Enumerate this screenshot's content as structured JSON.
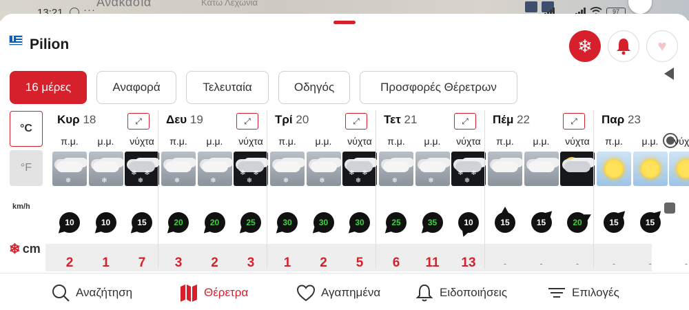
{
  "statusbar": {
    "time": "13:21",
    "battery": "97",
    "map_label": "Ανακασιά",
    "map_label_2": "Κατω Λεχώνια"
  },
  "header": {
    "title": "Pilion"
  },
  "tabs": [
    {
      "label": "16 μέρες",
      "active": true
    },
    {
      "label": "Αναφορά",
      "active": false
    },
    {
      "label": "Τελευταία",
      "active": false
    },
    {
      "label": "Οδηγός",
      "active": false
    },
    {
      "label": "Προσφορές Θέρετρων",
      "active": false
    }
  ],
  "units": {
    "celsius": "°C",
    "fahrenheit": "°F",
    "wind": "km/h",
    "snow": "cm"
  },
  "days": [
    {
      "name": "Κυρ",
      "date": "18",
      "parts": [
        "π.μ.",
        "μ.μ.",
        "νύχτα"
      ],
      "weather": [
        "cloud-snow",
        "cloud-snow",
        "night-snow"
      ],
      "wind": [
        "10",
        "10",
        "15"
      ],
      "wind_green": [
        false,
        false,
        false
      ],
      "snow": [
        "2",
        "1",
        "7"
      ]
    },
    {
      "name": "Δευ",
      "date": "19",
      "parts": [
        "π.μ.",
        "μ.μ.",
        "νύχτα"
      ],
      "weather": [
        "cloud-snow",
        "cloud-snow",
        "night-snow"
      ],
      "wind": [
        "20",
        "20",
        "25"
      ],
      "wind_green": [
        true,
        true,
        true
      ],
      "snow": [
        "3",
        "2",
        "3"
      ]
    },
    {
      "name": "Τρί",
      "date": "20",
      "parts": [
        "π.μ.",
        "μ.μ.",
        "νύχτα"
      ],
      "weather": [
        "cloud-snow",
        "cloud-snow",
        "night-snow"
      ],
      "wind": [
        "30",
        "30",
        "30"
      ],
      "wind_green": [
        true,
        true,
        true
      ],
      "snow": [
        "1",
        "2",
        "5"
      ]
    },
    {
      "name": "Τετ",
      "date": "21",
      "parts": [
        "π.μ.",
        "μ.μ.",
        "νύχτα"
      ],
      "weather": [
        "cloud-snow",
        "cloud-snow",
        "night-snow"
      ],
      "wind": [
        "25",
        "35",
        "10"
      ],
      "wind_green": [
        true,
        true,
        false
      ],
      "snow": [
        "6",
        "11",
        "13"
      ]
    },
    {
      "name": "Πέμ",
      "date": "22",
      "parts": [
        "π.μ.",
        "μ.μ.",
        "νύχτα"
      ],
      "weather": [
        "cloud",
        "cloud",
        "night-cloud"
      ],
      "wind": [
        "15",
        "15",
        "20"
      ],
      "wind_green": [
        false,
        false,
        true
      ],
      "snow": [
        "-",
        "-",
        "-"
      ]
    },
    {
      "name": "Παρ",
      "date": "23",
      "parts": [
        "π.μ.",
        "μ.μ.",
        "νύχτα"
      ],
      "weather": [
        "sunny",
        "sunny",
        "sunny"
      ],
      "wind": [
        "15",
        "15",
        ""
      ],
      "wind_green": [
        false,
        false,
        false
      ],
      "snow": [
        "-",
        "-",
        "-"
      ]
    }
  ],
  "nav": [
    {
      "label": "Αναζήτηση",
      "icon": "search-icon",
      "active": false
    },
    {
      "label": "Θέρετρα",
      "icon": "map-icon",
      "active": true
    },
    {
      "label": "Αγαπημένα",
      "icon": "heart-icon",
      "active": false
    },
    {
      "label": "Ειδοποιήσεις",
      "icon": "bell-icon",
      "active": false
    },
    {
      "label": "Επιλογές",
      "icon": "menu-icon",
      "active": false
    }
  ],
  "colors": {
    "accent": "#d6202c",
    "wind_green": "#3bd53b"
  }
}
